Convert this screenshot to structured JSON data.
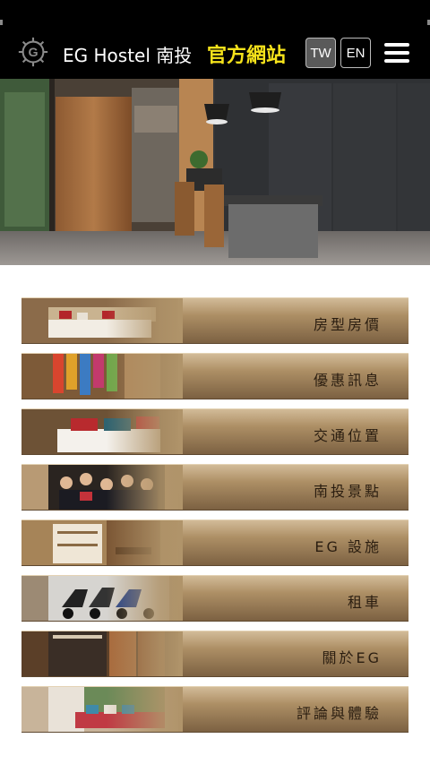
{
  "header": {
    "brand": "EG Hostel 南投",
    "official_site": "官方網站",
    "lang_tw": "TW",
    "lang_en": "EN",
    "logo_icon": "gear-g-logo-icon",
    "menu_icon": "hamburger-menu-icon",
    "official_color": "#f5e21b"
  },
  "hero": {
    "image": "hostel-lobby-photo"
  },
  "menu": {
    "items": [
      {
        "label": "房型房價",
        "thumb": "room-beds-photo"
      },
      {
        "label": "優惠訊息",
        "thumb": "colorful-banners-photo"
      },
      {
        "label": "交通位置",
        "thumb": "bed-pillows-photo"
      },
      {
        "label": "南投景點",
        "thumb": "group-people-photo"
      },
      {
        "label": "EG 設施",
        "thumb": "facility-room-photo"
      },
      {
        "label": "租車",
        "thumb": "scooters-photo"
      },
      {
        "label": "關於EG",
        "thumb": "hostel-entrance-photo"
      },
      {
        "label": "評論與體驗",
        "thumb": "lounge-sofa-photo"
      }
    ]
  }
}
